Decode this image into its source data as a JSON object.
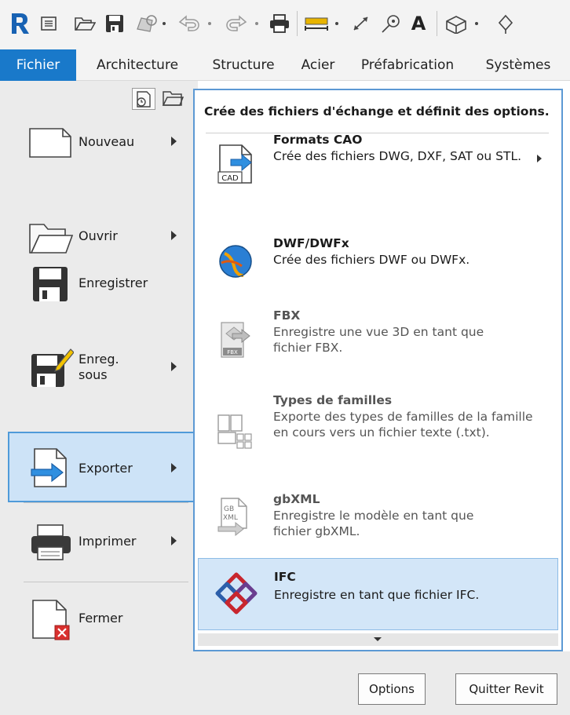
{
  "quick_access": {
    "items": [
      {
        "name": "revit-logo-icon"
      },
      {
        "name": "recent-files-icon"
      },
      {
        "name": "open-folder-icon"
      },
      {
        "name": "save-icon"
      },
      {
        "name": "sync-icon"
      },
      {
        "name": "undo-icon"
      },
      {
        "name": "redo-icon"
      },
      {
        "name": "print-icon"
      },
      {
        "name": "measure-icon"
      },
      {
        "name": "dimension-icon"
      },
      {
        "name": "tag-icon"
      },
      {
        "name": "text-icon"
      },
      {
        "name": "3d-view-icon"
      },
      {
        "name": "section-icon"
      }
    ],
    "text_glyph": "A"
  },
  "ribbon": {
    "tabs": [
      {
        "label": "Fichier",
        "active": true
      },
      {
        "label": "Architecture"
      },
      {
        "label": "Structure"
      },
      {
        "label": "Acier"
      },
      {
        "label": "Préfabrication"
      },
      {
        "label": "Systèmes"
      }
    ]
  },
  "app_menu": {
    "items": [
      {
        "label": "Nouveau",
        "has_submenu": true,
        "icon": "new-document-icon"
      },
      {
        "label": "Ouvrir",
        "has_submenu": true,
        "icon": "open-folder-icon"
      },
      {
        "label": "Enregistrer",
        "has_submenu": false,
        "icon": "save-icon"
      },
      {
        "label": "Enreg.\nsous",
        "has_submenu": true,
        "icon": "save-as-icon"
      },
      {
        "label": "Exporter",
        "has_submenu": true,
        "icon": "export-icon",
        "selected": true
      },
      {
        "label": "Imprimer",
        "has_submenu": true,
        "icon": "printer-icon"
      },
      {
        "label": "Fermer",
        "has_submenu": false,
        "icon": "close-document-icon"
      }
    ]
  },
  "submenu": {
    "title": "Crée des fichiers d'échange et définit des options.",
    "items": [
      {
        "title": "Formats CAO",
        "desc": "Crée des fichiers DWG, DXF, SAT ou STL.",
        "icon": "cad-export-icon",
        "has_submenu": true,
        "icon_text": "CAD"
      },
      {
        "title": "DWF/DWFx",
        "desc": "Crée des fichiers DWF ou DWFx.",
        "icon": "dwf-globe-icon"
      },
      {
        "title": "FBX",
        "desc": "Enregistre une vue 3D en tant que fichier FBX.",
        "icon": "fbx-icon",
        "icon_text": "FBX",
        "dim": true
      },
      {
        "title": "Types de familles",
        "desc": "Exporte des types de familles de la famille en cours vers un fichier texte (.txt).",
        "icon": "family-types-icon",
        "dim": true
      },
      {
        "title": "gbXML",
        "desc": "Enregistre le modèle en tant que fichier gbXML.",
        "icon": "gbxml-icon",
        "icon_text_1": "GB",
        "icon_text_2": "XML",
        "dim": true
      },
      {
        "title": "IFC",
        "desc": "Enregistre en tant que fichier IFC.",
        "icon": "ifc-icon",
        "highlighted": true
      }
    ]
  },
  "footer": {
    "options_label": "Options",
    "exit_label": "Quitter Revit"
  },
  "colors": {
    "accent": "#1979ca",
    "selected_bg": "#cde3f7",
    "selected_border": "#4f9ad9",
    "hover_bg": "#d3e6f8",
    "ifc_red": "#c8262e",
    "ifc_blue": "#2c5faa",
    "ifc_purple": "#6a3d8f"
  }
}
